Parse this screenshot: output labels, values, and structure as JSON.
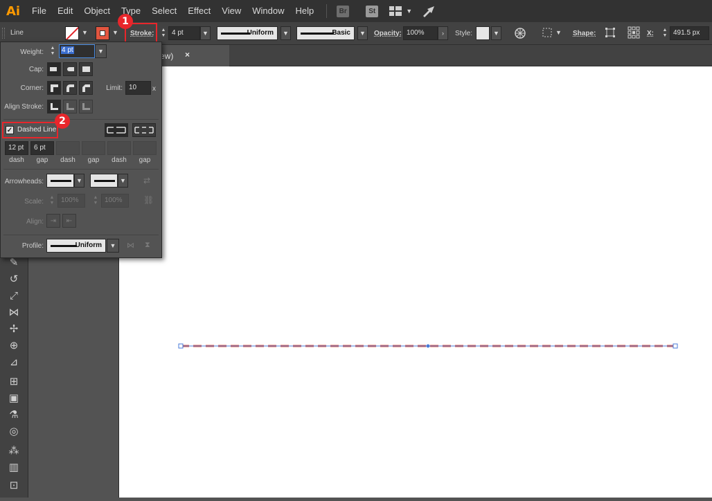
{
  "app": {
    "logo": "Ai"
  },
  "menu": [
    "File",
    "Edit",
    "Object",
    "Type",
    "Select",
    "Effect",
    "View",
    "Window",
    "Help"
  ],
  "menu_right": {
    "bridge": "Br",
    "stock": "St"
  },
  "control_bar": {
    "selection_type": "Line",
    "stroke_label": "Stroke:",
    "stroke_weight": "4 pt",
    "variable_width": "Uniform",
    "brush": "Basic",
    "opacity_label": "Opacity:",
    "opacity_value": "100%",
    "style_label": "Style:",
    "shape_label": "Shape:",
    "x_label": "X:",
    "x_value": "491.5 px"
  },
  "annotations": {
    "step1": "1",
    "step2": "2",
    "highlight_color": "#e8262b"
  },
  "document_tab": {
    "title": "ew)",
    "close": "×"
  },
  "stroke_panel": {
    "weight_label": "Weight:",
    "weight_value": "4 pt",
    "cap_label": "Cap:",
    "corner_label": "Corner:",
    "limit_label": "Limit:",
    "limit_value": "10",
    "limit_unit": "x",
    "align_label": "Align Stroke:",
    "dashed_label": "Dashed Line",
    "dashed_checked": true,
    "dash_values": [
      "12 pt",
      "6 pt",
      "",
      "",
      "",
      ""
    ],
    "dash_labels": [
      "dash",
      "gap",
      "dash",
      "gap",
      "dash",
      "gap"
    ],
    "arrowheads_label": "Arrowheads:",
    "scale_label": "Scale:",
    "scale_values": [
      "100%",
      "100%"
    ],
    "align_arrow_label": "Align:",
    "profile_label": "Profile:",
    "profile_value": "Uniform"
  },
  "artwork": {
    "stroke_color": "#e2553f",
    "path_color": "#4a7bd8"
  }
}
